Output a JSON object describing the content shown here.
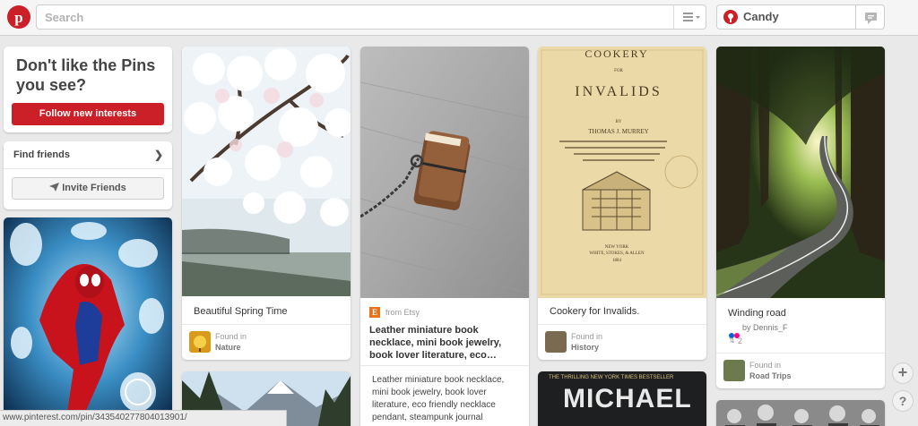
{
  "header": {
    "search_placeholder": "Search",
    "user_name": "Candy"
  },
  "sidebar": {
    "dont_like_title": "Don't like the Pins you see?",
    "follow_button": "Follow new interests",
    "find_friends": "Find friends",
    "invite_button": "Invite Friends"
  },
  "pins": [
    {
      "caption": "Beautiful Spring Time",
      "found_label": "Found in",
      "board": "Nature"
    },
    {
      "source": "from Etsy",
      "title": "Leather miniature book necklace, mini book jewelry, book lover literature, eco…",
      "description": "Leather miniature book necklace, mini book jewelry, book lover literature, eco friendly necklace pendant, steampunk journal"
    },
    {
      "cover_title": "COOKERY",
      "cover_for": "FOR",
      "cover_main": "INVALIDS",
      "cover_by": "BY",
      "cover_author": "THOMAS J. MURREY",
      "cover_publisher": "NEW YORK\nWHITE, STOKES, & ALLEN",
      "caption": "Cookery for Invalids.",
      "found_label": "Found in",
      "board": "History"
    },
    {
      "caption": "Winding road",
      "by_text": "by Dennis_F",
      "repins": "2",
      "found_label": "Found in",
      "board": "Road Trips"
    }
  ],
  "book_cover": {
    "tagline": "THE THRILLING NEW YORK TIMES BESTSELLER",
    "author": "MICHAEL"
  },
  "status_url": "www.pinterest.com/pin/343540277804013901/",
  "floating": {
    "add": "+",
    "help": "?"
  },
  "colors": {
    "brand_red": "#cb2027",
    "background": "#e9e9e9"
  },
  "icons": [
    "pinterest-logo-icon",
    "menu-icon",
    "notification-icon",
    "send-icon",
    "chevron-right-icon",
    "etsy-icon",
    "repin-icon",
    "add-icon",
    "help-icon"
  ]
}
